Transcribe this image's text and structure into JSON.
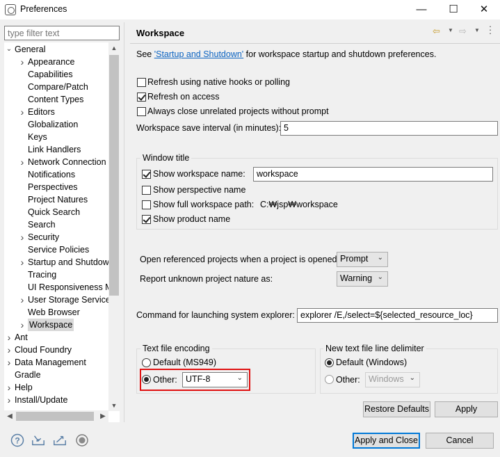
{
  "window": {
    "title": "Preferences",
    "minimize_glyph": "—",
    "maximize_glyph": "☐",
    "close_glyph": "✕"
  },
  "sidebar": {
    "filter_placeholder": "type filter text",
    "items": [
      {
        "label": "General",
        "level": 0,
        "expander": "expanded"
      },
      {
        "label": "Appearance",
        "level": 1,
        "expander": "collapsed"
      },
      {
        "label": "Capabilities",
        "level": 1,
        "expander": "none"
      },
      {
        "label": "Compare/Patch",
        "level": 1,
        "expander": "none"
      },
      {
        "label": "Content Types",
        "level": 1,
        "expander": "none"
      },
      {
        "label": "Editors",
        "level": 1,
        "expander": "collapsed"
      },
      {
        "label": "Globalization",
        "level": 1,
        "expander": "none"
      },
      {
        "label": "Keys",
        "level": 1,
        "expander": "none"
      },
      {
        "label": "Link Handlers",
        "level": 1,
        "expander": "none"
      },
      {
        "label": "Network Connection",
        "level": 1,
        "expander": "collapsed"
      },
      {
        "label": "Notifications",
        "level": 1,
        "expander": "none"
      },
      {
        "label": "Perspectives",
        "level": 1,
        "expander": "none"
      },
      {
        "label": "Project Natures",
        "level": 1,
        "expander": "none"
      },
      {
        "label": "Quick Search",
        "level": 1,
        "expander": "none"
      },
      {
        "label": "Search",
        "level": 1,
        "expander": "none"
      },
      {
        "label": "Security",
        "level": 1,
        "expander": "collapsed"
      },
      {
        "label": "Service Policies",
        "level": 1,
        "expander": "none"
      },
      {
        "label": "Startup and Shutdow",
        "level": 1,
        "expander": "collapsed"
      },
      {
        "label": "Tracing",
        "level": 1,
        "expander": "none"
      },
      {
        "label": "UI Responsiveness M",
        "level": 1,
        "expander": "none"
      },
      {
        "label": "User Storage Service",
        "level": 1,
        "expander": "collapsed"
      },
      {
        "label": "Web Browser",
        "level": 1,
        "expander": "none"
      },
      {
        "label": "Workspace",
        "level": 1,
        "expander": "collapsed",
        "selected": true
      },
      {
        "label": "Ant",
        "level": 0,
        "expander": "collapsed"
      },
      {
        "label": "Cloud Foundry",
        "level": 0,
        "expander": "collapsed"
      },
      {
        "label": "Data Management",
        "level": 0,
        "expander": "collapsed"
      },
      {
        "label": "Gradle",
        "level": 0,
        "expander": "none"
      },
      {
        "label": "Help",
        "level": 0,
        "expander": "collapsed"
      },
      {
        "label": "Install/Update",
        "level": 0,
        "expander": "collapsed"
      }
    ]
  },
  "page": {
    "title": "Workspace",
    "see_prefix": "See ",
    "see_link": "'Startup and Shutdown'",
    "see_suffix": " for workspace startup and shutdown preferences.",
    "checkboxes": [
      {
        "label": "Refresh using native hooks or polling",
        "checked": false
      },
      {
        "label": "Refresh on access",
        "checked": true
      },
      {
        "label": "Always close unrelated projects without prompt",
        "checked": false
      }
    ],
    "save_interval_label": "Workspace save interval (in minutes):",
    "save_interval_value": "5",
    "window_title": {
      "group_label": "Window title",
      "show_name_label": "Show workspace name:",
      "show_name_checked": true,
      "workspace_name_value": "workspace",
      "show_perspective_label": "Show perspective name",
      "show_perspective_checked": false,
      "show_path_label": "Show full workspace path:",
      "show_path_checked": false,
      "path_value": "C:₩jsp₩workspace",
      "show_product_label": "Show product name",
      "show_product_checked": true
    },
    "open_referenced_label": "Open referenced projects when a project is opened:",
    "open_referenced_value": "Prompt",
    "report_unknown_label": "Report unknown project nature as:",
    "report_unknown_value": "Warning",
    "explorer_label": "Command for launching system explorer:",
    "explorer_value": "explorer /E,/select=${selected_resource_loc}",
    "encoding": {
      "group_label": "Text file encoding",
      "default_label": "Default (MS949)",
      "default_selected": false,
      "other_label": "Other:",
      "other_selected": true,
      "other_value": "UTF-8"
    },
    "delimiter": {
      "group_label": "New text file line delimiter",
      "default_label": "Default (Windows)",
      "default_selected": true,
      "other_label": "Other:",
      "other_selected": false,
      "other_value": "Windows"
    },
    "restore_defaults_label": "Restore Defaults",
    "apply_label": "Apply"
  },
  "footer": {
    "apply_close_label": "Apply and Close",
    "cancel_label": "Cancel"
  },
  "colors": {
    "highlight_border": "#e01010",
    "default_button_border": "#0078d7",
    "link": "#0b63c1"
  }
}
